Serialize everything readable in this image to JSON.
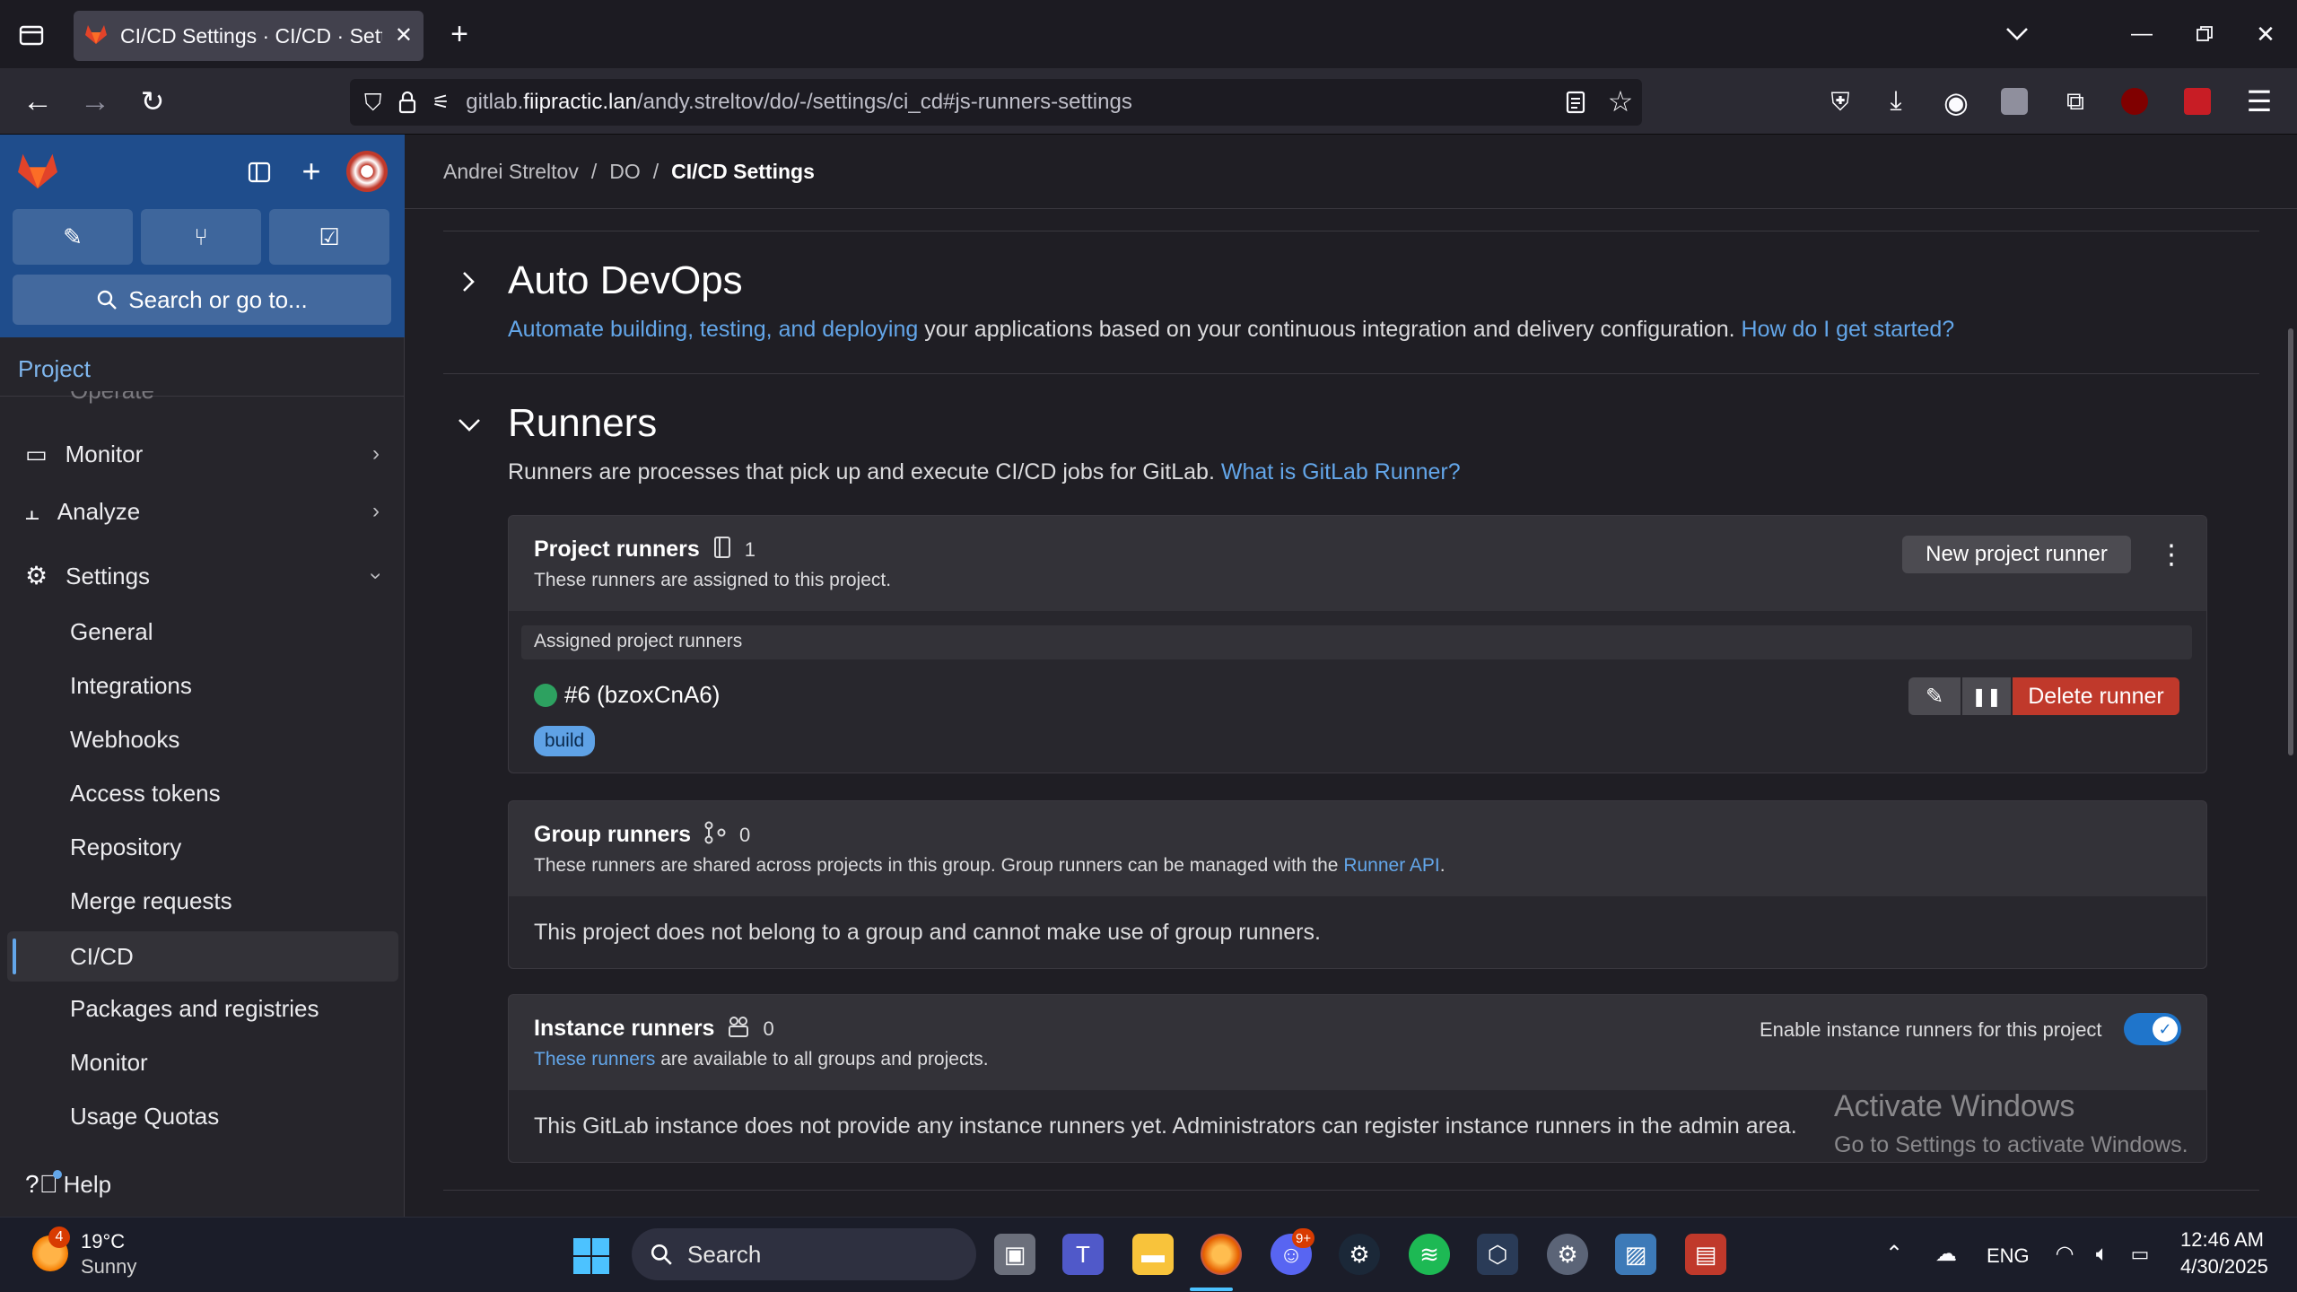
{
  "browser": {
    "tab_title": "CI/CD Settings · CI/CD · Settings",
    "url_prefix": "gitlab.",
    "url_domain": "fiipractic.lan",
    "url_path": "/andy.streltov/do/-/settings/ci_cd#js-runners-settings"
  },
  "sidebar": {
    "search_placeholder": "Search or go to...",
    "section": "Project",
    "hidden_item": "Operate",
    "items": [
      "Monitor",
      "Analyze",
      "Settings"
    ],
    "settings_subitems": [
      "General",
      "Integrations",
      "Webhooks",
      "Access tokens",
      "Repository",
      "Merge requests",
      "CI/CD",
      "Packages and registries",
      "Monitor",
      "Usage Quotas"
    ],
    "help": "Help"
  },
  "breadcrumb": {
    "user": "Andrei Streltov",
    "project": "DO",
    "current": "CI/CD Settings",
    "sep": "/"
  },
  "auto_devops": {
    "title": "Auto DevOps",
    "link1": "Automate building, testing, and deploying",
    "text": " your applications based on your continuous integration and delivery configuration. ",
    "link2": "How do I get started?"
  },
  "runners": {
    "title": "Runners",
    "text": "Runners are processes that pick up and execute CI/CD jobs for GitLab. ",
    "link": "What is GitLab Runner?",
    "project": {
      "title": "Project runners",
      "count": "1",
      "subtitle": "These runners are assigned to this project.",
      "new_button": "New project runner",
      "assigned_header": "Assigned project runners",
      "runner_name": "#6 (bzoxCnA6)",
      "tag": "build",
      "delete_button": "Delete runner"
    },
    "group": {
      "title": "Group runners",
      "count": "0",
      "subtitle": "These runners are shared across projects in this group. Group runners can be managed with the ",
      "subtitle_link": "Runner API",
      "subtitle_end": ".",
      "body": "This project does not belong to a group and cannot make use of group runners."
    },
    "instance": {
      "title": "Instance runners",
      "count": "0",
      "sub_link": "These runners",
      "subtitle": " are available to all groups and projects.",
      "toggle_label": "Enable instance runners for this project",
      "toggle_on": true,
      "body": "This GitLab instance does not provide any instance runners yet. Administrators can register instance runners in the admin area."
    }
  },
  "watermark": {
    "line1": "Activate Windows",
    "line2": "Go to Settings to activate Windows."
  },
  "taskbar": {
    "weather_temp": "19°C",
    "weather_desc": "Sunny",
    "weather_badge": "4",
    "search": "Search",
    "discord_badge": "9+",
    "lang": "ENG",
    "time": "12:46 AM",
    "date": "4/30/2025"
  },
  "colors": {
    "accent": "#63a6e9",
    "sidebar_header": "#1f4d8c",
    "danger": "#c0392b",
    "online": "#2da160"
  }
}
